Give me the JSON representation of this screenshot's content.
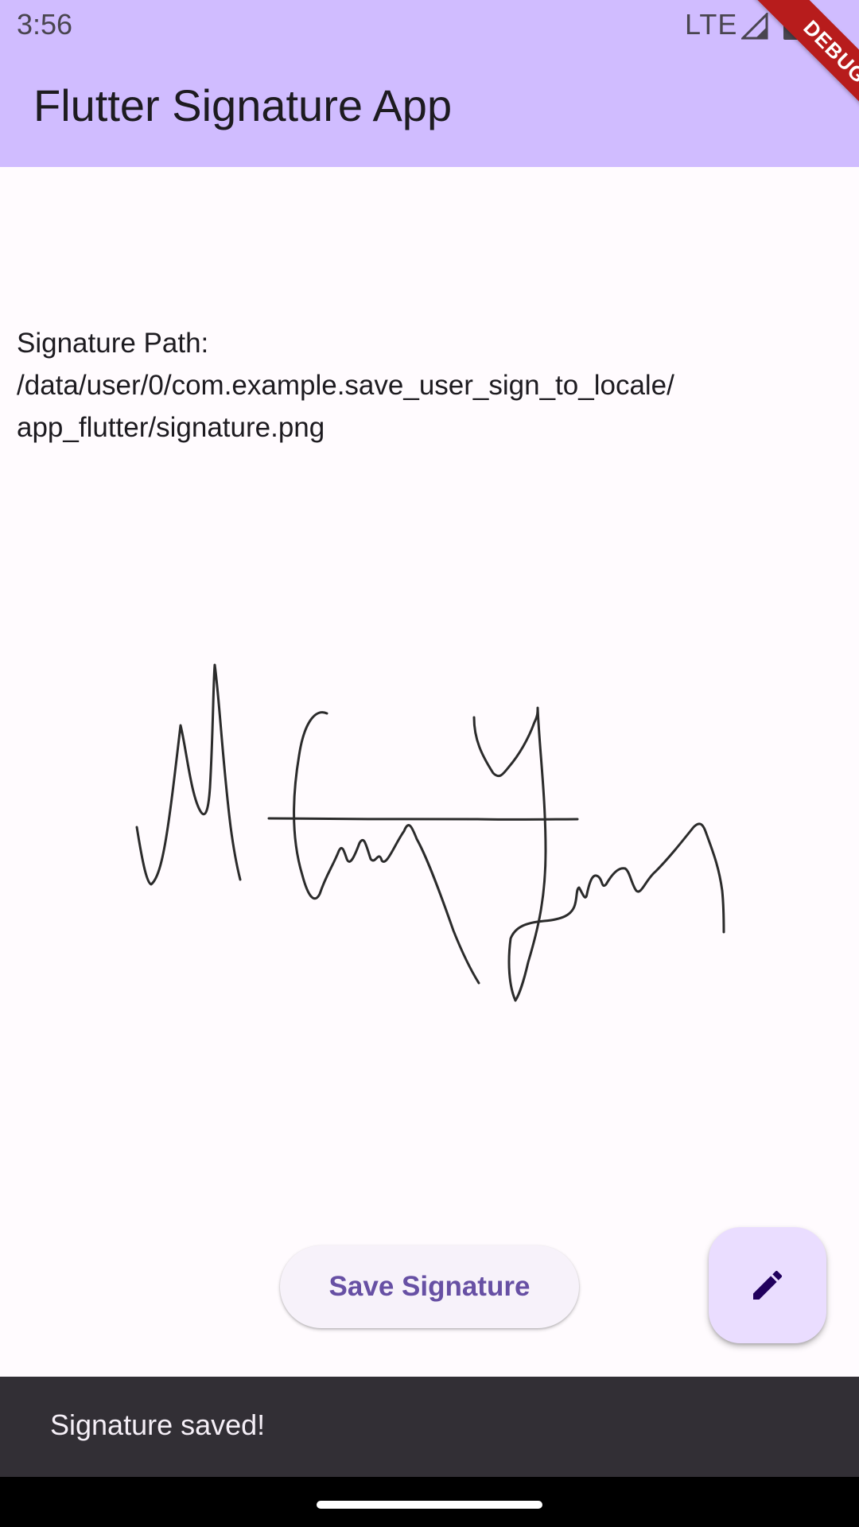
{
  "status_bar": {
    "time": "3:56",
    "network": "LTE"
  },
  "app_bar": {
    "title": "Flutter Signature App"
  },
  "debug_banner": {
    "label": "DEBUG"
  },
  "signature_path": {
    "line1": "Signature Path:",
    "line2": "/data/user/0/com.example.save_user_sign_to_locale/",
    "line3": "app_flutter/signature.png"
  },
  "signature_image": {
    "icon": "handwritten-signature"
  },
  "actions": {
    "save_label": "Save Signature",
    "fab_icon": "pencil-icon"
  },
  "snackbar": {
    "message": "Signature saved!"
  },
  "colors": {
    "app_bar": "#d0bcff",
    "background": "#fffbfe",
    "primary": "#6750a4",
    "fab": "#eaddff",
    "snackbar": "#322f35",
    "debug_banner": "#b71c1c"
  }
}
